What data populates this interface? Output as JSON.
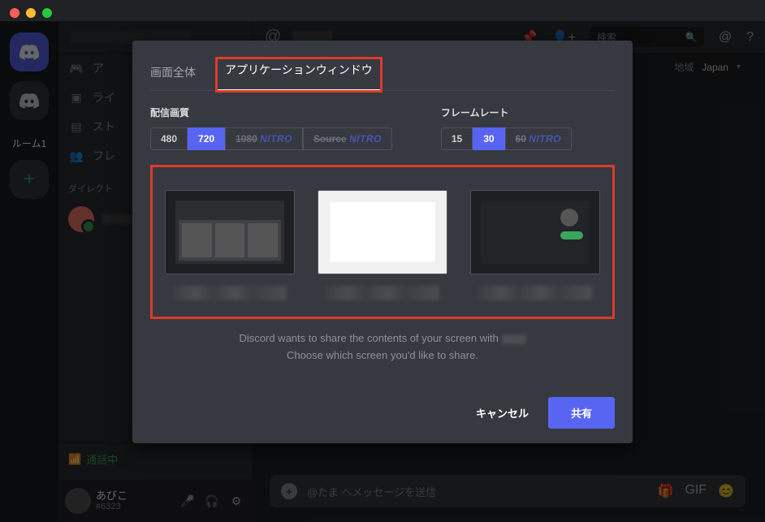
{
  "sidebar": {
    "room_label": "ルーム1",
    "channels": [
      {
        "label": "ア"
      },
      {
        "label": "ライ"
      },
      {
        "label": "スト"
      },
      {
        "label": "フレ"
      }
    ],
    "dm_header": "ダイレクト",
    "call_status": "通話中",
    "user": {
      "name": "あびこ",
      "tag": "#6323"
    }
  },
  "topbar": {
    "search_placeholder": "検索",
    "region": {
      "label": "地域",
      "value": "Japan"
    }
  },
  "message_input": {
    "placeholder": "@たま へメッセージを送信"
  },
  "modal": {
    "tabs": {
      "fullscreen": "画面全体",
      "app_window": "アプリケーションウィンドウ"
    },
    "quality": {
      "label": "配信画質",
      "options": [
        "480",
        "720",
        "1080",
        "Source"
      ],
      "nitro_tag": "NITRO",
      "active": "720"
    },
    "framerate": {
      "label": "フレームレート",
      "options": [
        "15",
        "30",
        "60"
      ],
      "nitro_tag": "NITRO",
      "active": "30"
    },
    "share_line1_a": "Discord wants to share the contents of your screen with ",
    "share_line2": "Choose which screen you'd like to share.",
    "cancel": "キャンセル",
    "share": "共有"
  }
}
